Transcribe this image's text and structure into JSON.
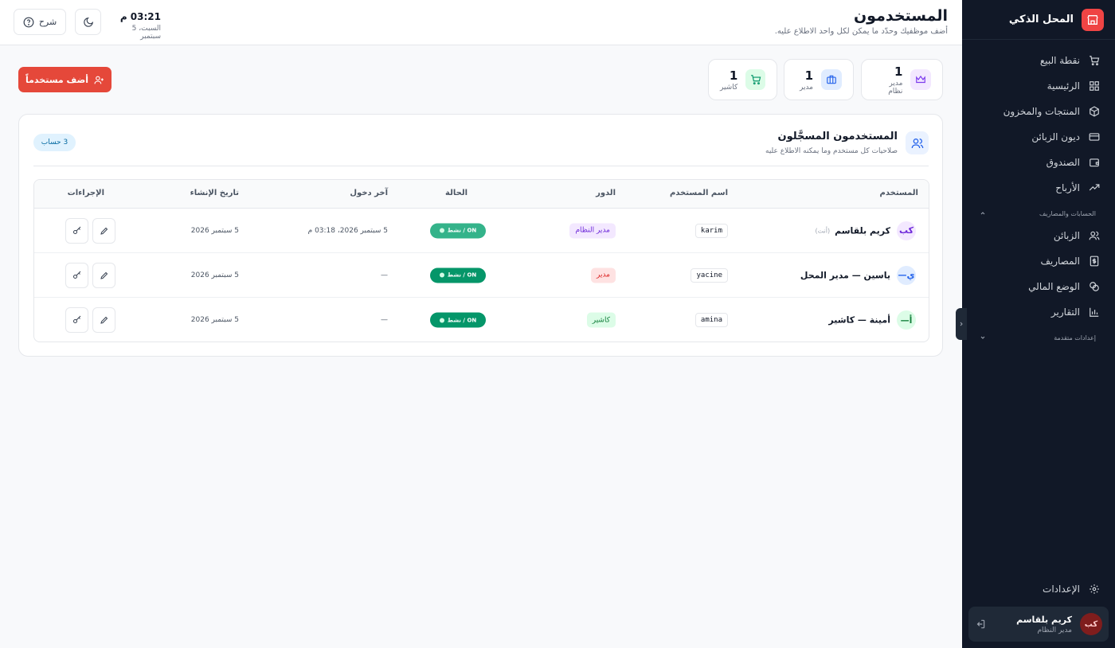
{
  "brand": {
    "name": "المحل الذكي"
  },
  "nav": {
    "items": [
      {
        "label": "نقطة البيع",
        "icon": "cart-icon"
      },
      {
        "label": "الرئيسية",
        "icon": "grid-icon"
      },
      {
        "label": "المنتجات والمخزون",
        "icon": "box-icon"
      },
      {
        "label": "ديون الزبائن",
        "icon": "card-icon"
      },
      {
        "label": "الصندوق",
        "icon": "wallet-icon"
      },
      {
        "label": "الأرباح",
        "icon": "trend-up-icon"
      }
    ],
    "group_accounts": "الحسابات والمصاريف",
    "group_items": [
      {
        "label": "الزبائن",
        "icon": "users-icon"
      },
      {
        "label": "المصاريف",
        "icon": "dollar-icon"
      },
      {
        "label": "الوضع المالي",
        "icon": "coins-icon"
      },
      {
        "label": "التقارير",
        "icon": "bar-chart-icon"
      }
    ],
    "group_advanced": "إعدادات متقدمة",
    "settings": "الإعدادات"
  },
  "current_user": {
    "initials": "كب",
    "name": "كريم بلقاسم",
    "role": "مدير النظام"
  },
  "header": {
    "title": "المستخدمون",
    "subtitle": "أضف موظفيك وحدّد ما يمكن لكل واحد الاطلاع عليه.",
    "time": "03:21 م",
    "date": "السبت، 5 سبتمبر",
    "help_label": "شرح"
  },
  "stats": [
    {
      "count": "1",
      "label": "مدير نظام",
      "icon": "crown-icon",
      "color": "#7c3aed",
      "bg": "#f3e8ff"
    },
    {
      "count": "1",
      "label": "مدير",
      "icon": "briefcase-icon",
      "color": "#2563eb",
      "bg": "#e0ecff"
    },
    {
      "count": "1",
      "label": "كاشير",
      "icon": "cart-icon",
      "color": "#059669",
      "bg": "#dcfce7"
    }
  ],
  "add_user_label": "أضف مستخدماً",
  "users_card": {
    "title": "المستخدمون المسجَّلون",
    "subtitle": "صلاحيات كل مستخدم وما يمكنه الاطلاع عليه",
    "count_badge": "3 حساب"
  },
  "table": {
    "columns": {
      "user": "المستخدم",
      "username": "اسم المستخدم",
      "role": "الدور",
      "status": "الحالة",
      "last_login": "آخر دخول",
      "created": "تاريخ الإنشاء",
      "actions": "الإجراءات"
    },
    "rows": [
      {
        "initials": "كب",
        "name": "كريم بلقاسم",
        "you": "(أنت)",
        "username": "karim",
        "role": "مدير النظام",
        "role_color": "#6d28d9",
        "role_bg": "#f3e8ff",
        "avatar_color": "#6d28d9",
        "avatar_bg": "#f3e8ff",
        "status": "ON / نشط",
        "last_login": "5 سبتمبر 2026، 03:18 م",
        "created": "5 سبتمبر 2026"
      },
      {
        "initials": "ي—",
        "name": "ياسين — مدير المحل",
        "you": "",
        "username": "yacine",
        "role": "مدير",
        "role_color": "#dc2626",
        "role_bg": "#fee2e2",
        "avatar_color": "#2563eb",
        "avatar_bg": "#e0ecff",
        "status": "ON / نشط",
        "last_login": "—",
        "created": "5 سبتمبر 2026"
      },
      {
        "initials": "أ—",
        "name": "أمينة — كاشير",
        "you": "",
        "username": "amina",
        "role": "كاشير",
        "role_color": "#15803d",
        "role_bg": "#dcfce7",
        "avatar_color": "#15803d",
        "avatar_bg": "#dcfce7",
        "status": "ON / نشط",
        "last_login": "—",
        "created": "5 سبتمبر 2026"
      }
    ]
  }
}
